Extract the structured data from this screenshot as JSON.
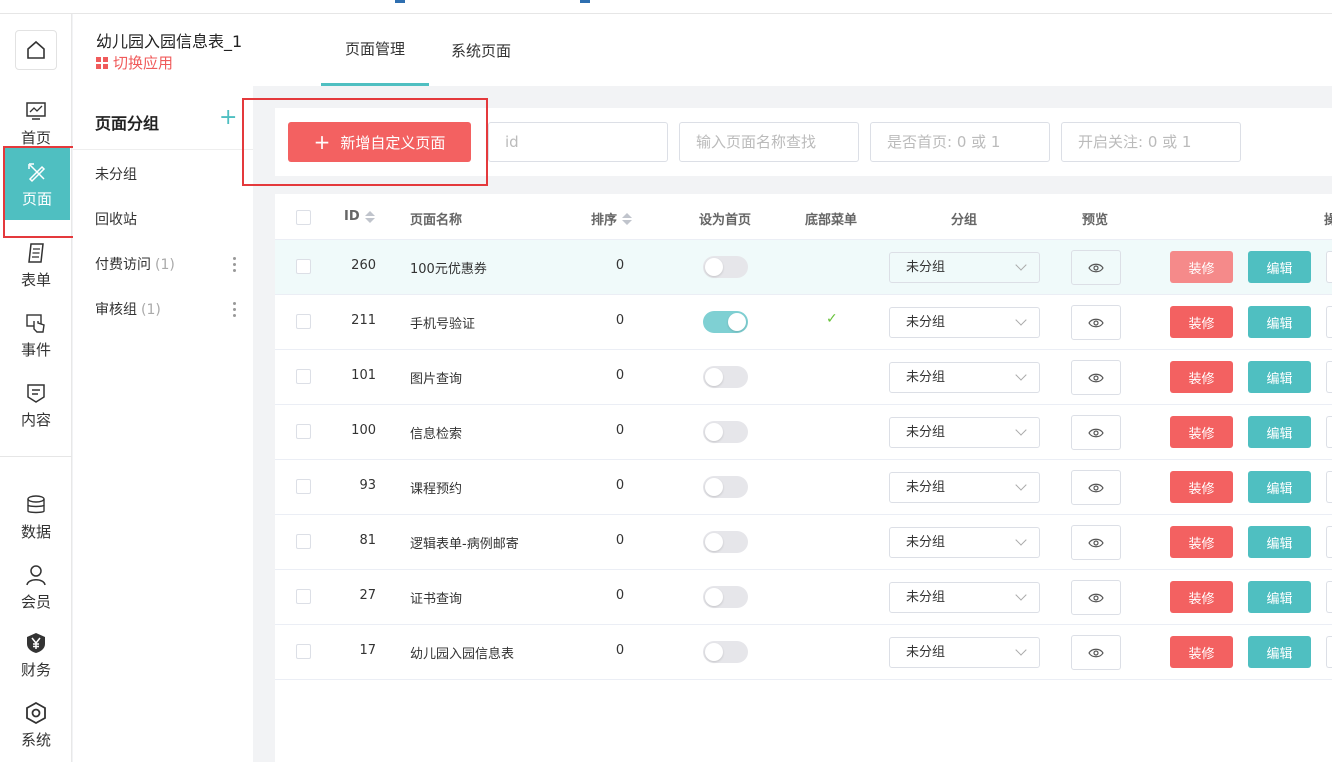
{
  "app": {
    "title": "幼儿园入园信息表_1",
    "switch_label": "切换应用"
  },
  "colors": {
    "accent": "#4fbfc1",
    "primary_red": "#f36161",
    "highlight_box": "#e4393c"
  },
  "left_nav": {
    "items": [
      {
        "label": "首页",
        "icon": "chart-monitor-icon"
      },
      {
        "label": "页面",
        "icon": "pencil-ruler-icon",
        "active": true
      },
      {
        "label": "表单",
        "icon": "form-doc-icon"
      },
      {
        "label": "事件",
        "icon": "hand-touch-icon"
      },
      {
        "label": "内容",
        "icon": "content-shield-icon"
      },
      {
        "label": "数据",
        "icon": "database-icon"
      },
      {
        "label": "会员",
        "icon": "user-icon"
      },
      {
        "label": "财务",
        "icon": "yen-shield-icon"
      },
      {
        "label": "系统",
        "icon": "hex-settings-icon"
      }
    ]
  },
  "tabs": [
    {
      "label": "页面管理",
      "active": true
    },
    {
      "label": "系统页面",
      "active": false
    }
  ],
  "groups": {
    "title": "页面分组",
    "items": [
      {
        "label": "未分组",
        "count": ""
      },
      {
        "label": "回收站",
        "count": ""
      },
      {
        "label": "付费访问",
        "count": "(1)"
      },
      {
        "label": "审核组",
        "count": "(1)"
      }
    ]
  },
  "toolbar": {
    "add_label": "新增自定义页面",
    "id_placeholder": "id",
    "name_placeholder": "输入页面名称查找",
    "home_placeholder": "是否首页: 0 或 1",
    "follow_placeholder": "开启关注: 0 或 1"
  },
  "table": {
    "headers": {
      "id": "ID",
      "name": "页面名称",
      "sort": "排序",
      "set_home": "设为首页",
      "bottom_menu": "底部菜单",
      "group": "分组",
      "preview": "预览",
      "ops": "操"
    },
    "decorate_label": "装修",
    "edit_label": "编辑",
    "rows": [
      {
        "id": "260",
        "name": "100元优惠券",
        "sort": "0",
        "home": false,
        "bottom": "",
        "group": "未分组"
      },
      {
        "id": "211",
        "name": "手机号验证",
        "sort": "0",
        "home": true,
        "bottom": "✓",
        "group": "未分组"
      },
      {
        "id": "101",
        "name": "图片查询",
        "sort": "0",
        "home": false,
        "bottom": "",
        "group": "未分组"
      },
      {
        "id": "100",
        "name": "信息检索",
        "sort": "0",
        "home": false,
        "bottom": "",
        "group": "未分组"
      },
      {
        "id": "93",
        "name": "课程预约",
        "sort": "0",
        "home": false,
        "bottom": "",
        "group": "未分组"
      },
      {
        "id": "81",
        "name": "逻辑表单-病例邮寄",
        "sort": "0",
        "home": false,
        "bottom": "",
        "group": "未分组"
      },
      {
        "id": "27",
        "name": "证书查询",
        "sort": "0",
        "home": false,
        "bottom": "",
        "group": "未分组"
      },
      {
        "id": "17",
        "name": "幼儿园入园信息表",
        "sort": "0",
        "home": false,
        "bottom": "",
        "group": "未分组"
      }
    ]
  }
}
